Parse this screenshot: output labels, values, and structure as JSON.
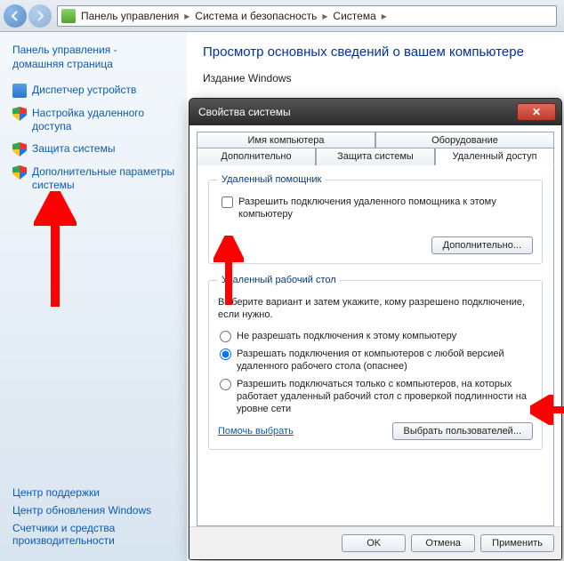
{
  "breadcrumb": {
    "items": [
      "Панель управления",
      "Система и безопасность",
      "Система"
    ]
  },
  "sidebar": {
    "home_line1": "Панель управления -",
    "home_line2": "домашняя страница",
    "links": [
      {
        "label": "Диспетчер устройств"
      },
      {
        "label": "Настройка удаленного доступа"
      },
      {
        "label": "Защита системы"
      },
      {
        "label": "Дополнительные параметры системы"
      }
    ],
    "bottom": [
      "Центр поддержки",
      "Центр обновления Windows",
      "Счетчики и средства производительности"
    ]
  },
  "content": {
    "heading": "Просмотр основных сведений о вашем компьютере",
    "section1": "Издание Windows"
  },
  "dialog": {
    "title": "Свойства системы",
    "tabs_row1": [
      "Имя компьютера",
      "Оборудование"
    ],
    "tabs_row2": [
      "Дополнительно",
      "Защита системы",
      "Удаленный доступ"
    ],
    "active_tab": "Удаленный доступ",
    "remote_assist": {
      "legend": "Удаленный помощник",
      "checkbox_label": "Разрешить подключения удаленного помощника к этому компьютеру",
      "advanced_btn": "Дополнительно..."
    },
    "remote_desktop": {
      "legend": "Удаленный рабочий стол",
      "desc": "Выберите вариант и затем укажите, кому разрешено подключение, если нужно.",
      "opt1": "Не разрешать подключения к этому компьютеру",
      "opt2": "Разрешать подключения от компьютеров с любой версией удаленного рабочего стола (опаснее)",
      "opt3": "Разрешить подключаться только с компьютеров, на которых работает удаленный рабочий стол с проверкой подлинности на уровне сети",
      "help_link": "Помочь выбрать",
      "select_users_btn": "Выбрать пользователей..."
    },
    "footer": {
      "ok": "OK",
      "cancel": "Отмена",
      "apply": "Применить"
    }
  }
}
